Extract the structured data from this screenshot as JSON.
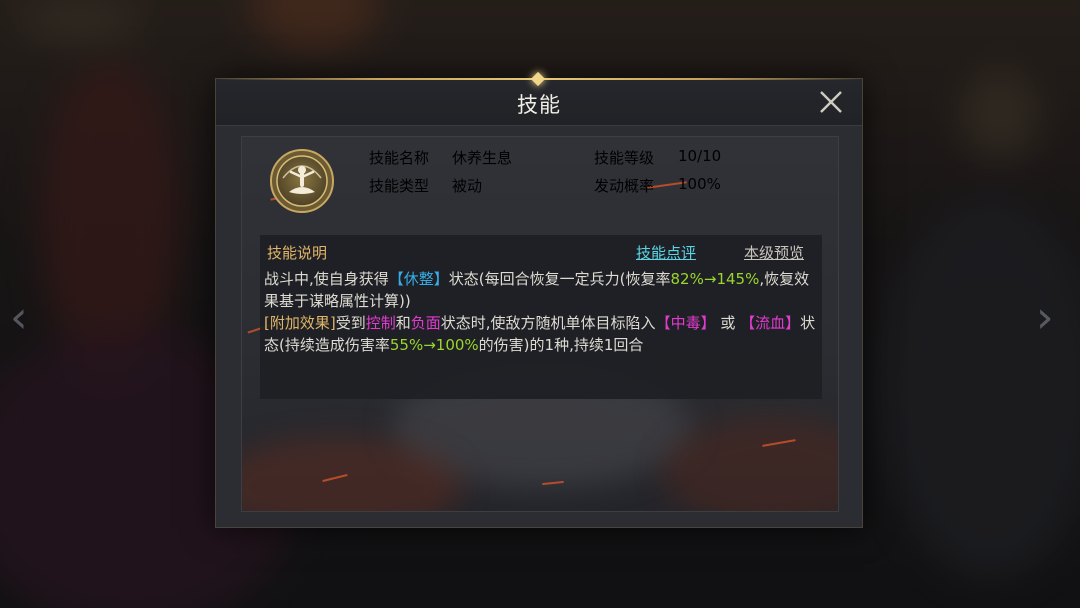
{
  "dialog": {
    "title": "技能",
    "close_icon": "close-icon"
  },
  "skill": {
    "icon": "meditation-icon",
    "name_label": "技能名称",
    "name_value": "休养生息",
    "level_label": "技能等级",
    "level_value": "10/10",
    "type_label": "技能类型",
    "type_value": "被动",
    "rate_label": "发动概率",
    "rate_value": "100%"
  },
  "description": {
    "title": "技能说明",
    "review_link": "技能点评",
    "preview_link": "本级预览",
    "line1_a": "战斗中,使自身获得",
    "tag_rest": "【休整】",
    "line1_b": "状态(每回合恢复一定兵力(恢复率",
    "rate_from": "82%",
    "arrow_1": "→",
    "rate_to": "145%",
    "line1_c": ",恢复效果基于谋略属性计算))",
    "extra_tag": "[附加效果]",
    "line2_a": "受到",
    "kw_control": "控制",
    "line2_b": "和",
    "kw_negative": "负面",
    "line2_c": "状态时,使敌方随机单体目标陷入",
    "tag_poison": "【中毒】",
    "line2_d": " 或 ",
    "tag_bleed": "【流血】",
    "line2_e": "状态(持续造成伤害率",
    "dmg_from": "55%",
    "arrow_2": "→",
    "dmg_to": "100%",
    "line2_f": "的伤害)的1种,持续1回合"
  },
  "colors": {
    "gold": "#e0b668",
    "cyan": "#5ad6e6",
    "blue_tag": "#35aee8",
    "magenta": "#e23bd0",
    "green": "#9ad62c"
  }
}
